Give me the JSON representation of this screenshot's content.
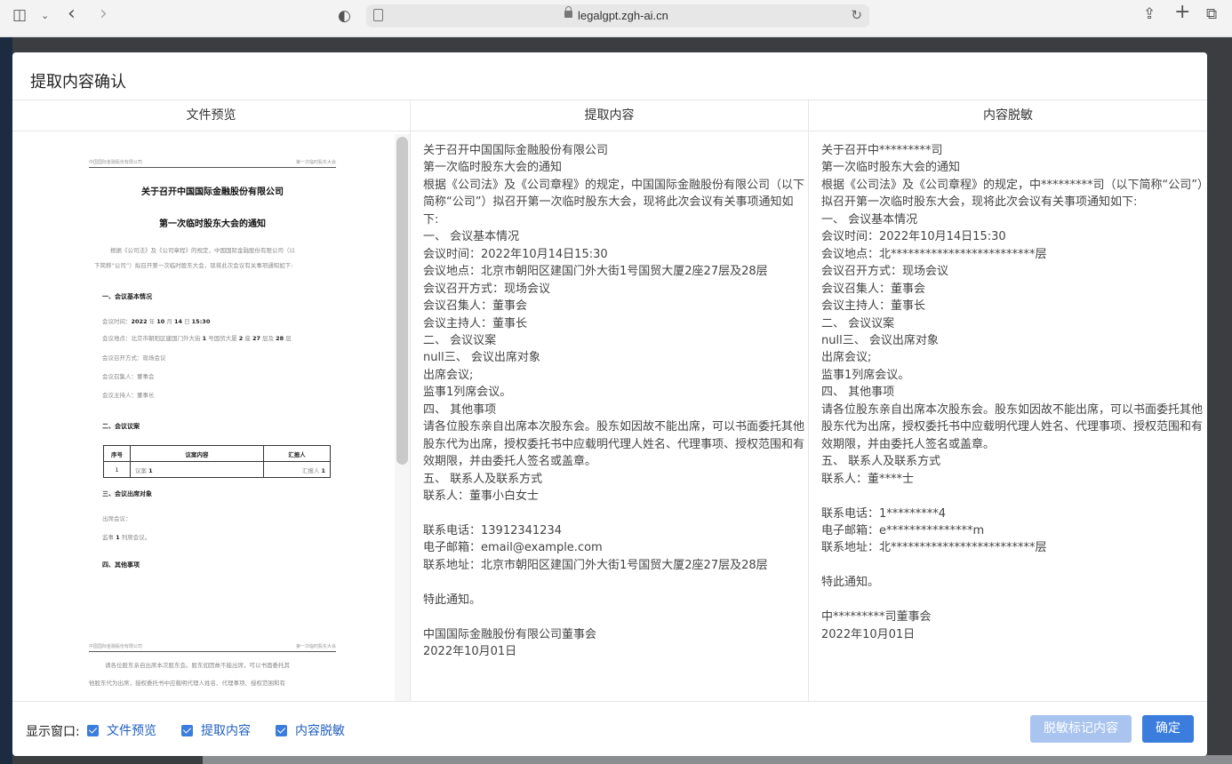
{
  "browser": {
    "url": "legalgpt.zgh-ai.cn"
  },
  "modal": {
    "title": "提取内容确认",
    "col_preview": "文件预览",
    "col_extract": "提取内容",
    "col_mask": "内容脱敏"
  },
  "preview_doc": {
    "header_left": "中国国际金融股份有限公司",
    "header_right": "第一次临时股东大会",
    "title1": "关于召开中国国际金融股份有限公司",
    "title2": "第一次临时股东大会的通知",
    "intro1": "根据《公司法》及《公司章程》的规定，中国国际金融股份有限公司（以",
    "intro2": "下简称“公司”）拟召开第一次临时股东大会，现将此次会议有关事项通知如下:",
    "sec1": "一、会议基本情况",
    "time_label": "会议时间：",
    "time_a": "2022",
    "time_b": "年",
    "time_c": "10",
    "time_d": "月",
    "time_e": "14",
    "time_f": "日",
    "time_g": "15:30",
    "place_label": "会议地点：北京市朝阳区建国门外大街",
    "place_a": "1",
    "place_b": "号国贸大厦",
    "place_c": "2",
    "place_d": "座",
    "place_e": "27",
    "place_f": "层及",
    "place_g": "28",
    "place_h": "层",
    "mode": "会议召开方式：现场会议",
    "convener": "会议召集人：董事会",
    "host": "会议主持人：董事长",
    "sec2": "二、会议议案",
    "th_no": "序号",
    "th_content": "议案内容",
    "th_reporter": "汇报人",
    "row_no": "1",
    "row_content_a": "议案",
    "row_content_b": "1",
    "row_reporter_a": "汇报人",
    "row_reporter_b": "1",
    "sec3": "三、会议出席对象",
    "attend1": "出席会议：",
    "attend2_a": "监事",
    "attend2_b": "1",
    "attend2_c": "列席会议。",
    "sec4": "四、其他事项",
    "p2_line1": "请各位股东亲自出席本次股东会。股东如因故不能出席，可以书面委托其",
    "p2_line2": "他股东代为出席，授权委托书中应载明代理人姓名、代理事项、授权范围和有"
  },
  "extracted_text": "关于召开中国国际金融股份有限公司\n第一次临时股东大会的通知\n根据《公司法》及《公司章程》的规定，中国国际金融股份有限公司（以下简称“公司”）拟召开第一次临时股东大会，现将此次会议有关事项通知如下:\n一、 会议基本情况\n会议时间：2022年10月14日15:30\n会议地点：北京市朝阳区建国门外大街1号国贸大厦2座27层及28层\n会议召开方式：现场会议\n会议召集人：董事会\n会议主持人：董事长\n二、 会议议案\nnull三、 会议出席对象\n出席会议;\n监事1列席会议。\n四、 其他事项\n请各位股东亲自出席本次股东会。股东如因故不能出席，可以书面委托其他股东代为出席，授权委托书中应载明代理人姓名、代理事项、授权范围和有效期限，并由委托人签名或盖章。\n五、 联系人及联系方式\n联系人：董事小白女士\n\n联系电话：13912341234\n电子邮箱：email@example.com\n联系地址：北京市朝阳区建国门外大街1号国贸大厦2座27层及28层\n\n特此通知。\n\n中国国际金融股份有限公司董事会\n2022年10月01日",
  "masked_text": "关于召开中*********司\n第一次临时股东大会的通知\n根据《公司法》及《公司章程》的规定，中*********司（以下简称“公司”）拟召开第一次临时股东大会，现将此次会议有关事项通知如下:\n一、 会议基本情况\n会议时间：2022年10月14日15:30\n会议地点：北*************************层\n会议召开方式：现场会议\n会议召集人：董事会\n会议主持人：董事长\n二、 会议议案\nnull三、 会议出席对象\n出席会议;\n监事1列席会议。\n四、 其他事项\n请各位股东亲自出席本次股东会。股东如因故不能出席，可以书面委托其他股东代为出席，授权委托书中应载明代理人姓名、代理事项、授权范围和有效期限，并由委托人签名或盖章。\n五、 联系人及联系方式\n联系人：董****士\n\n联系电话：1*********4\n电子邮箱：e***************m\n联系地址：北*************************层\n\n特此通知。\n\n中*********司董事会\n2022年10月01日",
  "footer": {
    "label": "显示窗口:",
    "cb_preview": "文件预览",
    "cb_extract": "提取内容",
    "cb_mask": "内容脱敏",
    "btn_mask": "脱敏标记内容",
    "btn_ok": "确定"
  },
  "colors": {
    "primary": "#3b7ddd",
    "primary_disabled": "#a9c4ef"
  }
}
